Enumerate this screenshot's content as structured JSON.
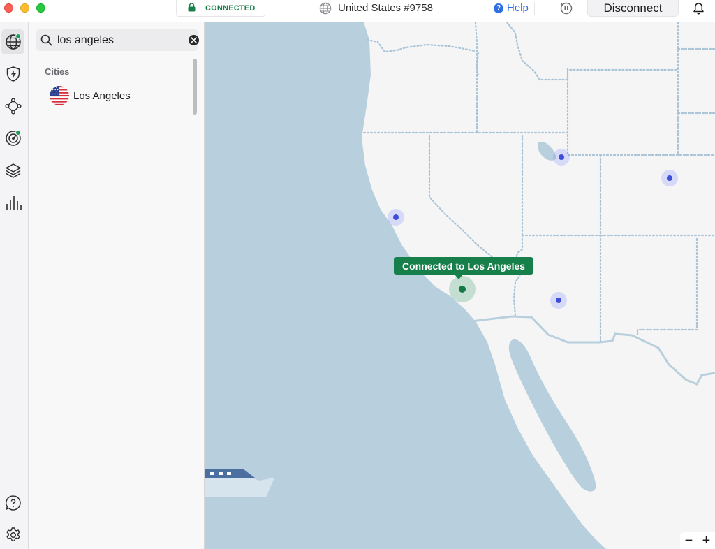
{
  "titlebar": {
    "status": "CONNECTED",
    "server": "United States #9758",
    "help": "Help",
    "disconnect": "Disconnect"
  },
  "sidebar": {
    "items": [
      {
        "name": "countries",
        "icon": "globe-icon",
        "active": true,
        "badge": true
      },
      {
        "name": "threat-protection",
        "icon": "shield-bolt-icon",
        "active": false,
        "badge": false
      },
      {
        "name": "meshnet",
        "icon": "meshnet-icon",
        "active": false,
        "badge": false
      },
      {
        "name": "dark-web-monitor",
        "icon": "radar-icon",
        "active": false,
        "badge": true
      },
      {
        "name": "specialty-servers",
        "icon": "layers-icon",
        "active": false,
        "badge": false
      },
      {
        "name": "statistics",
        "icon": "bar-chart-icon",
        "active": false,
        "badge": false
      }
    ],
    "bottom": [
      {
        "name": "support",
        "icon": "question-bubble-icon"
      },
      {
        "name": "settings",
        "icon": "gear-icon"
      }
    ]
  },
  "panel": {
    "search_value": "los angeles",
    "section_title": "Cities",
    "results": [
      {
        "label": "Los Angeles",
        "flag": "us-flag-icon"
      }
    ]
  },
  "map": {
    "tooltip": "Connected to Los Angeles",
    "zoom_out": "−",
    "zoom_in": "+"
  },
  "colors": {
    "connected_green": "#177f4a",
    "ocean": "#b8cfdd",
    "land": "#f5f5f6",
    "server_blue": "#3c4fd6",
    "help_blue": "#2f6fe4"
  }
}
